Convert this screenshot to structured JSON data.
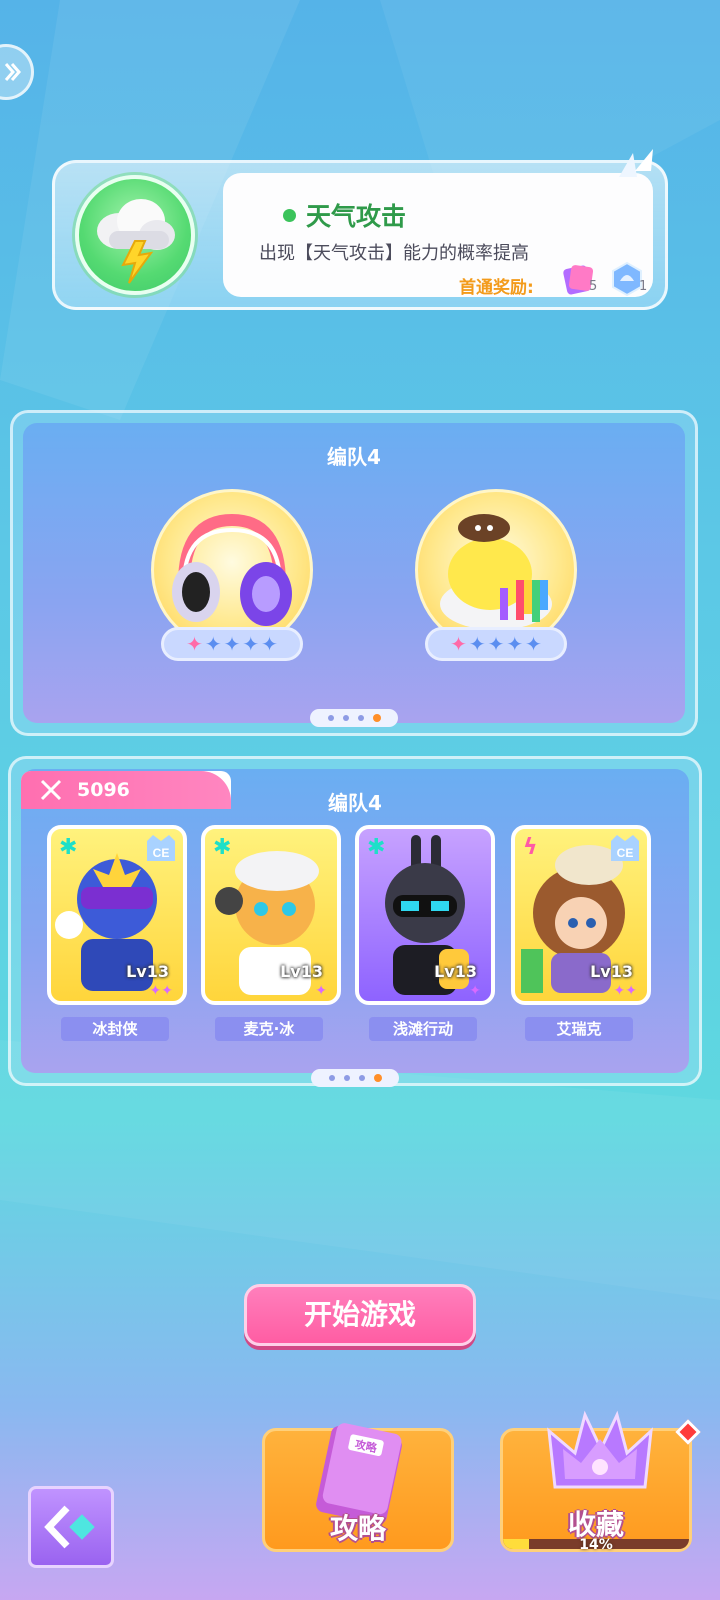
{
  "weather": {
    "title": "天气攻击",
    "description": "出现【天气攻击】能力的概率提高",
    "reward_label": "首通奖励:",
    "rewards": [
      {
        "icon": "coupon-icon",
        "count": "5"
      },
      {
        "icon": "blue-crystal-icon",
        "count": "1"
      }
    ]
  },
  "pet_panel": {
    "title": "编队4",
    "pets": [
      {
        "name": "headphones-pet",
        "stars": 5,
        "lit_stars": 1
      },
      {
        "name": "rainbow-blob-pet",
        "stars": 5,
        "lit_stars": 1
      }
    ],
    "pages": 4,
    "current_page": 4
  },
  "team_panel": {
    "title": "编队4",
    "power": "5096",
    "heroes": [
      {
        "name": "冰封侠",
        "level": "Lv13",
        "type": "ice",
        "badge": "CE",
        "star_count": 2
      },
      {
        "name": "麦克·冰",
        "level": "Lv13",
        "type": "ice",
        "badge": "",
        "star_count": 1
      },
      {
        "name": "浅滩行动",
        "level": "Lv13",
        "type": "ice",
        "badge": "",
        "star_count": 1
      },
      {
        "name": "艾瑞克",
        "level": "Lv13",
        "type": "lightning",
        "badge": "CE",
        "star_count": 2
      }
    ],
    "pages": 4,
    "current_page": 4
  },
  "start_button": "开始游戏",
  "guide_button": {
    "label": "攻略",
    "book_text": "攻略"
  },
  "collection_button": {
    "label": "收藏",
    "progress": "14%",
    "progress_value": 0.14
  },
  "colors": {
    "accent_pink": "#ff5da3",
    "accent_orange": "#ff9a1e",
    "panel_blue": "#7aa8f2"
  }
}
